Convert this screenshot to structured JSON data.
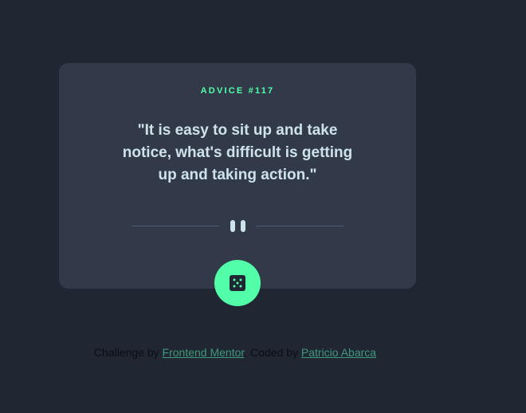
{
  "card": {
    "label": "ADVICE #117",
    "quote": "\"It is easy to sit up and take notice, what's difficult is getting up and taking action.\""
  },
  "icons": {
    "divider": "pause-icon",
    "button": "dice-icon"
  },
  "attribution": {
    "prefix": "Challenge by",
    "link1": "Frontend Mentor",
    "middle": ". Coded by",
    "link2": "Patricio Abarca"
  },
  "colors": {
    "background": "#202632",
    "card": "#323a49",
    "accent": "#52ffa8",
    "text": "#cee3e9",
    "divider": "#4f5d74"
  }
}
